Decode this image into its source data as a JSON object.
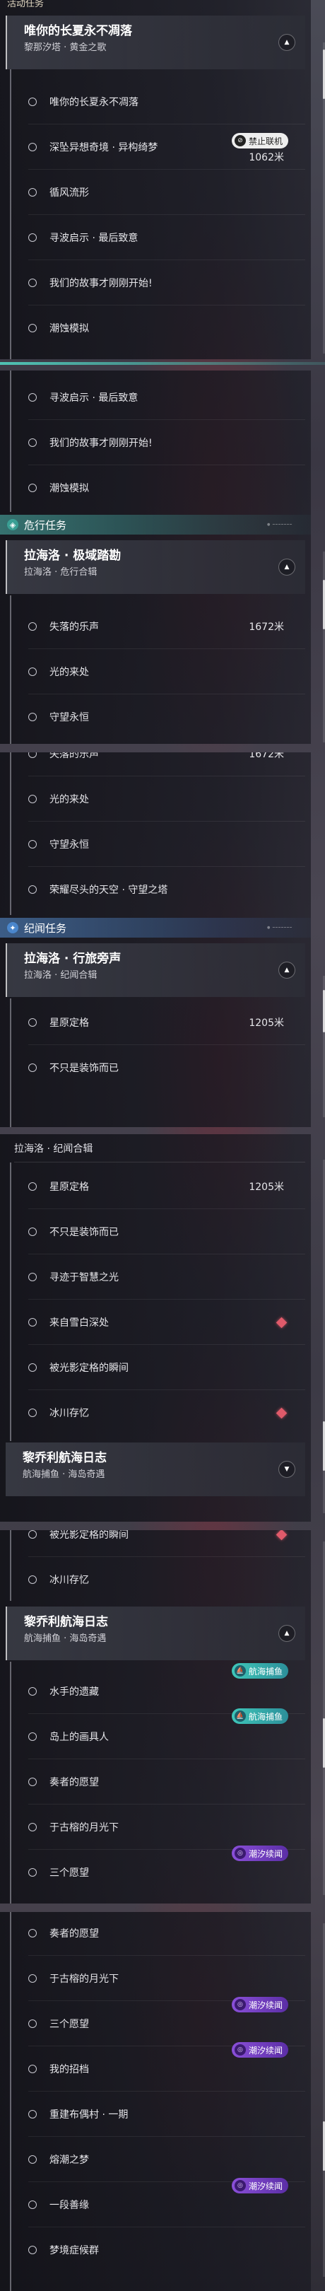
{
  "colors": {
    "event_accent": "#e08a4a",
    "danger_accent": "#4fc2b4",
    "chronicle_accent": "#5e9ee0",
    "alert_diamond": "#e05a6a"
  },
  "s1": {
    "category": "活动任务",
    "group_title": "唯你的长夏永不凋落",
    "group_sub": "黎那汐塔 · 黄金之歌",
    "items": [
      {
        "label": "唯你的长夏永不凋落"
      },
      {
        "label": "深坠异想奇境 · 异构绮梦",
        "badge": "禁止联机",
        "badge_icon": "link-off-icon",
        "dist": "1062米"
      },
      {
        "label": "循风流形"
      },
      {
        "label": "寻波启示 · 最后致意"
      },
      {
        "label": "我们的故事才刚刚开始!"
      },
      {
        "label": "潮蚀模拟"
      }
    ]
  },
  "s2": {
    "items": [
      {
        "label": "寻波启示 · 最后致意"
      },
      {
        "label": "我们的故事才刚刚开始!"
      },
      {
        "label": "潮蚀模拟"
      }
    ],
    "category": "危行任务",
    "group_title": "拉海洛 · 极域踏勘",
    "group_sub": "拉海洛 · 危行合辑",
    "items2": [
      {
        "label": "失落的乐声",
        "dist": "1672米"
      },
      {
        "label": "光的来处"
      },
      {
        "label": "守望永恒"
      }
    ]
  },
  "s3": {
    "partial": {
      "label": "失落的乐声",
      "dist": "1672米"
    },
    "items": [
      {
        "label": "光的来处"
      },
      {
        "label": "守望永恒"
      },
      {
        "label": "荣耀尽头的天空 · 守望之塔"
      }
    ],
    "category": "纪闻任务",
    "group_title": "拉海洛 · 行旅旁声",
    "group_sub": "拉海洛 · 纪闻合辑",
    "items2": [
      {
        "label": "星原定格",
        "dist": "1205米"
      },
      {
        "label": "不只是装饰而已"
      }
    ]
  },
  "s4": {
    "sub_head": "拉海洛 · 纪闻合辑",
    "items": [
      {
        "label": "星原定格",
        "dist": "1205米"
      },
      {
        "label": "不只是装饰而已"
      },
      {
        "label": "寻迹于智慧之光"
      },
      {
        "label": "来自雪白深处"
      },
      {
        "label": "被光影定格的瞬间"
      },
      {
        "label": "冰川存忆"
      }
    ],
    "group_title": "黎乔利航海日志",
    "group_sub": "航海捕鱼 · 海岛奇遇"
  },
  "s5": {
    "partial": {
      "label": "被光影定格的瞬间"
    },
    "items": [
      {
        "label": "冰川存忆"
      }
    ],
    "group_title": "黎乔利航海日志",
    "group_sub": "航海捕鱼 · 海岛奇遇",
    "items2": [
      {
        "label": "水手的遗藏",
        "badge": "航海捕鱼",
        "badge_icon": "sail-icon"
      },
      {
        "label": "岛上的画具人",
        "badge": "航海捕鱼",
        "badge_icon": "sail-icon"
      },
      {
        "label": "奏者的愿望"
      },
      {
        "label": "于古榕的月光下"
      },
      {
        "label": "三个愿望",
        "badge": "潮汐续闻",
        "badge_icon": "tide-icon"
      }
    ]
  },
  "s6": {
    "items": [
      {
        "label": "奏者的愿望"
      },
      {
        "label": "于古榕的月光下"
      },
      {
        "label": "三个愿望",
        "badge": "潮汐续闻",
        "badge_icon": "tide-icon"
      },
      {
        "label": "我的招档",
        "badge": "潮汐续闻",
        "badge_icon": "tide-icon"
      },
      {
        "label": "重建布偶村 · 一期"
      },
      {
        "label": "熔潮之梦"
      },
      {
        "label": "一段善缘",
        "badge": "潮汐续闻",
        "badge_icon": "tide-icon"
      },
      {
        "label": "梦境症候群"
      }
    ]
  }
}
